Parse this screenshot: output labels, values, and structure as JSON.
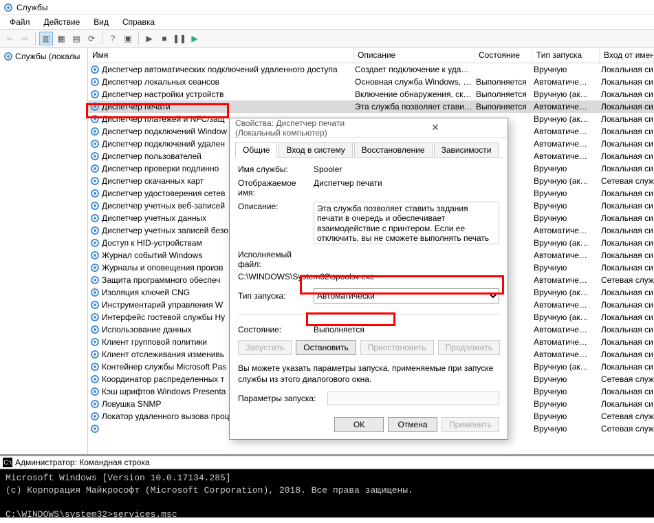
{
  "window_title": "Службы",
  "menu": [
    "Файл",
    "Действие",
    "Вид",
    "Справка"
  ],
  "tree_item": "Службы (локалы",
  "columns": {
    "name": "Имя",
    "desc": "Описание",
    "state": "Состояние",
    "startup": "Тип запуска",
    "logon": "Вход от имени"
  },
  "services": [
    {
      "name": "Диспетчер автоматических подключений удаленного доступа",
      "desc": "Создает подключение к уда…",
      "state": "",
      "startup": "Вручную",
      "logon": "Локальная си…"
    },
    {
      "name": "Диспетчер локальных сеансов",
      "desc": "Основная служба Windows, …",
      "state": "Выполняется",
      "startup": "Автоматиче…",
      "logon": "Локальная си…"
    },
    {
      "name": "Диспетчер настройки устройств",
      "desc": "Включение обнаружения, ск…",
      "state": "Выполняется",
      "startup": "Вручную (ак…",
      "logon": "Локальная си…"
    },
    {
      "name": "Диспетчер печати",
      "desc": "Эта служба позволяет стави…",
      "state": "Выполняется",
      "startup": "Автоматиче…",
      "logon": "Локальная си…",
      "selected": true
    },
    {
      "name": "Диспетчер платежей и NFC/защ",
      "desc": "",
      "state": "",
      "startup": "Вручную (ак…",
      "logon": "Локальная си…"
    },
    {
      "name": "Диспетчер подключений Window",
      "desc": "",
      "state": "няется",
      "startup": "Автоматиче…",
      "logon": "Локальная си…"
    },
    {
      "name": "Диспетчер подключений удален",
      "desc": "",
      "state": "",
      "startup": "Автоматиче…",
      "logon": "Локальная си…"
    },
    {
      "name": "Диспетчер пользователей",
      "desc": "",
      "state": "няется",
      "startup": "Автоматиче…",
      "logon": "Локальная си…"
    },
    {
      "name": "Диспетчер проверки подлинно",
      "desc": "",
      "state": "",
      "startup": "Вручную",
      "logon": "Локальная си…"
    },
    {
      "name": "Диспетчер скачанных карт",
      "desc": "",
      "state": "",
      "startup": "Вручную (ак…",
      "logon": "Сетевая служ…"
    },
    {
      "name": "Диспетчер удостоверения сетев",
      "desc": "",
      "state": "",
      "startup": "Вручную",
      "logon": "Локальная си…"
    },
    {
      "name": "Диспетчер учетных веб-записей",
      "desc": "",
      "state": "няется",
      "startup": "Вручную",
      "logon": "Локальная си…"
    },
    {
      "name": "Диспетчер учетных данных",
      "desc": "",
      "state": "няется",
      "startup": "Вручную",
      "logon": "Локальная си…"
    },
    {
      "name": "Диспетчер учетных записей безо",
      "desc": "",
      "state": "няется",
      "startup": "Автоматиче…",
      "logon": "Локальная си…"
    },
    {
      "name": "Доступ к HID-устройствам",
      "desc": "",
      "state": "",
      "startup": "Вручную (ак…",
      "logon": "Локальная си…"
    },
    {
      "name": "Журнал событий Windows",
      "desc": "",
      "state": "няется",
      "startup": "Автоматиче…",
      "logon": "Локальная си…"
    },
    {
      "name": "Журналы и оповещения произв",
      "desc": "",
      "state": "",
      "startup": "Вручную",
      "logon": "Локальная си…"
    },
    {
      "name": "Защита программного обеспеч",
      "desc": "",
      "state": "",
      "startup": "Автоматиче…",
      "logon": "Сетевая служ…"
    },
    {
      "name": "Изоляция ключей CNG",
      "desc": "",
      "state": "няется",
      "startup": "Вручную (ак…",
      "logon": "Локальная си…"
    },
    {
      "name": "Инструментарий управления W",
      "desc": "",
      "state": "няется",
      "startup": "Автоматиче…",
      "logon": "Локальная си…"
    },
    {
      "name": "Интерфейс гостевой службы Hy",
      "desc": "",
      "state": "",
      "startup": "Вручную (ак…",
      "logon": "Локальная си…"
    },
    {
      "name": "Использование данных",
      "desc": "",
      "state": "няется",
      "startup": "Автоматиче…",
      "logon": "Локальная си…"
    },
    {
      "name": "Клиент групповой политики",
      "desc": "",
      "state": "няется",
      "startup": "Автоматиче…",
      "logon": "Локальная си…"
    },
    {
      "name": "Клиент отслеживания изменивь",
      "desc": "",
      "state": "няется",
      "startup": "Автоматиче…",
      "logon": "Локальная си…"
    },
    {
      "name": "Контейнер службы Microsoft Pas",
      "desc": "",
      "state": "",
      "startup": "Вручную (ак…",
      "logon": "Локальная си…"
    },
    {
      "name": "Координатор распределенных т",
      "desc": "",
      "state": "",
      "startup": "Вручную",
      "logon": "Сетевая служ…"
    },
    {
      "name": "Кэш шрифтов Windows Presenta",
      "desc": "",
      "state": "няется",
      "startup": "Вручную",
      "logon": "Локальная си…"
    },
    {
      "name": "Ловушка SNMP",
      "desc": "",
      "state": "",
      "startup": "Вручную",
      "logon": "Локальная си…"
    },
    {
      "name": "Локатор удаленного вызова проц…",
      "desc": "",
      "state": "",
      "startup": "Вручную",
      "logon": "Сетевая служ…"
    },
    {
      "name": "",
      "desc": "",
      "state": "",
      "startup": "Вручную",
      "logon": "Сетевая служ…"
    }
  ],
  "dialog": {
    "title": "Свойства: Диспетчер печати (Локальный компьютер)",
    "tabs": [
      "Общие",
      "Вход в систему",
      "Восстановление",
      "Зависимости"
    ],
    "labels": {
      "service_name": "Имя службы:",
      "display_name": "Отображаемое имя:",
      "description": "Описание:",
      "exe": "Исполняемый файл:",
      "startup": "Тип запуска:",
      "state": "Состояние:",
      "params": "Параметры запуска:",
      "info": "Вы можете указать параметры запуска, применяемые при запуске службы из этого диалогового окна."
    },
    "values": {
      "service_name": "Spooler",
      "display_name": "Диспетчер печати",
      "description": "Эта служба позволяет ставить задания печати в очередь и обеспечивает взаимодействие с принтером. Если ее отключить, вы не сможете выполнять печать и видеть свои принтеры.",
      "exe": "C:\\WINDOWS\\System32\\spoolsv.exe",
      "startup": "Автоматически",
      "state": "Выполняется"
    },
    "buttons": {
      "start": "Запустить",
      "stop": "Остановить",
      "pause": "Приостановить",
      "resume": "Продолжить",
      "ok": "ОК",
      "cancel": "Отмена",
      "apply": "Применить"
    }
  },
  "console": {
    "title": "Администратор: Командная строка",
    "lines": "Microsoft Windows [Version 10.0.17134.285]\n(c) Корпорация Майкрософт (Microsoft Corporation), 2018. Все права защищены.\n\nC:\\WINDOWS\\system32>services.msc"
  }
}
